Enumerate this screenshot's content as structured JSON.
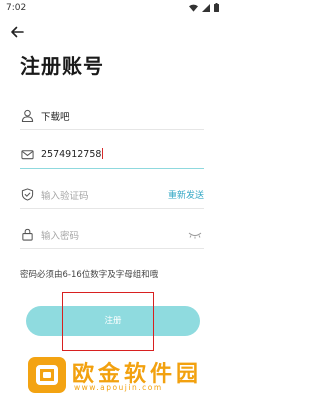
{
  "status_bar": {
    "time": "7:02"
  },
  "header": {
    "title": "注册账号"
  },
  "form": {
    "username": {
      "value": "下载吧"
    },
    "phone": {
      "value": "2574912758"
    },
    "code": {
      "placeholder": "输入验证码",
      "resend_label": "重新发送"
    },
    "password": {
      "placeholder": "输入密码"
    },
    "hint": "密码必须由6-16位数字及字母组和哦",
    "register_label": "注册"
  },
  "watermark": {
    "title": "欧金软件园",
    "url": "www.apoujin.com"
  },
  "colors": {
    "accent": "#8fdbdf",
    "link": "#35a8c6",
    "highlight": "#d82020",
    "watermark": "#f2a10f"
  }
}
